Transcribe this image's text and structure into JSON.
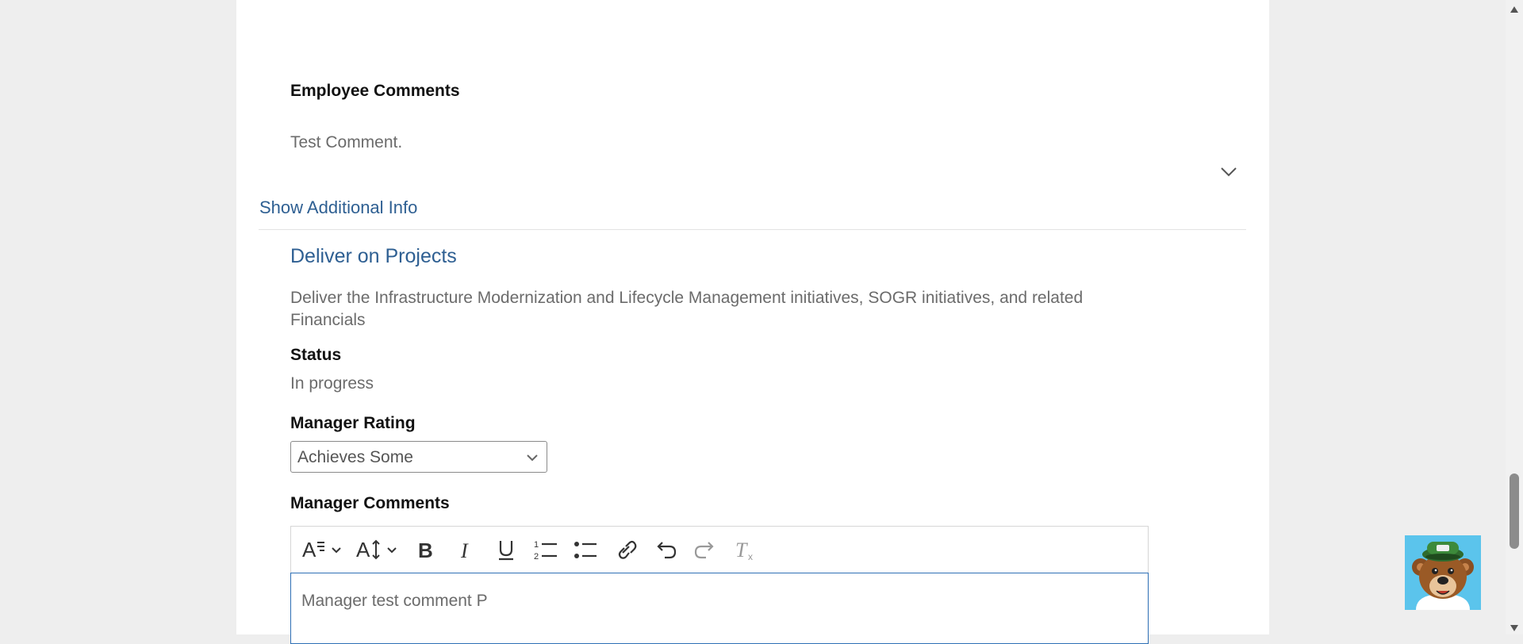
{
  "employee_comments": {
    "label": "Employee Comments",
    "text": "Test Comment."
  },
  "additional_info": {
    "link": "Show Additional Info"
  },
  "goal": {
    "title": "Deliver on Projects",
    "description_line1": "Deliver the Infrastructure Modernization and Lifecycle Management initiatives, SOGR initiatives, and related",
    "description_line2": "Financials",
    "status_label": "Status",
    "status_value": "In progress",
    "manager_rating_label": "Manager Rating",
    "manager_rating_value": "Achieves Some",
    "manager_comments_label": "Manager Comments",
    "manager_comments_value": "Manager test comment P"
  },
  "toolbar": {
    "icons": [
      "font-style-icon",
      "font-size-icon",
      "bold-icon",
      "italic-icon",
      "underline-icon",
      "numbered-list-icon",
      "bullet-list-icon",
      "link-icon",
      "undo-icon",
      "redo-icon",
      "clear-format-icon"
    ]
  },
  "colors": {
    "accent": "#2e5f92",
    "editor_focus": "#2e6fb5",
    "assistant_bg": "#5bc4ec"
  }
}
